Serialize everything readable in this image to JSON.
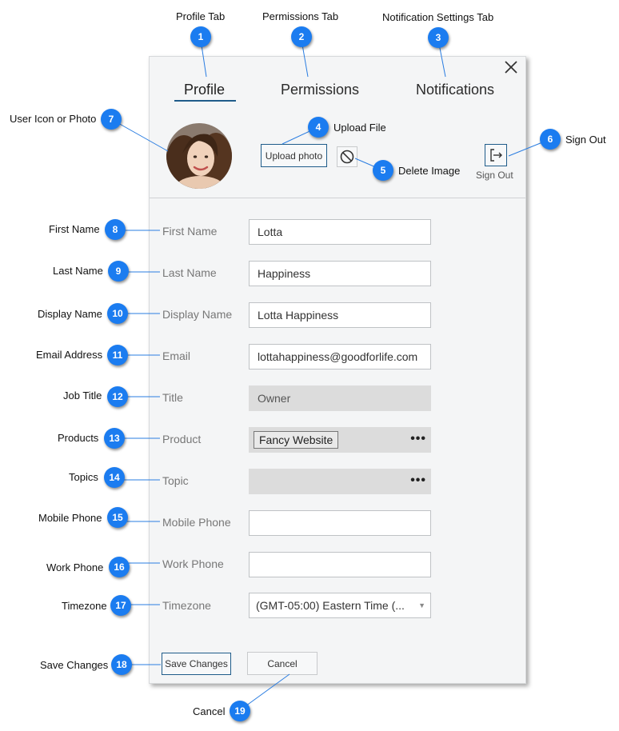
{
  "tabs": [
    {
      "label": "Profile",
      "active": true
    },
    {
      "label": "Permissions",
      "active": false
    },
    {
      "label": "Notifications",
      "active": false
    }
  ],
  "profile": {
    "upload_label": "Upload photo",
    "signout_label": "Sign Out"
  },
  "fields": {
    "first_name": {
      "label": "First Name",
      "value": "Lotta"
    },
    "last_name": {
      "label": "Last Name",
      "value": "Happiness"
    },
    "display_name": {
      "label": "Display Name",
      "value": "Lotta Happiness"
    },
    "email": {
      "label": "Email",
      "value": "lottahappiness@goodforlife.com"
    },
    "title": {
      "label": "Title",
      "value": "Owner"
    },
    "product": {
      "label": "Product",
      "chip": "Fancy Website"
    },
    "topic": {
      "label": "Topic"
    },
    "mobile_phone": {
      "label": "Mobile Phone",
      "value": ""
    },
    "work_phone": {
      "label": "Work Phone",
      "value": ""
    },
    "timezone": {
      "label": "Timezone",
      "value": "(GMT-05:00) Eastern Time (..."
    }
  },
  "more_glyph": "•••",
  "actions": {
    "save_label": "Save Changes",
    "cancel_label": "Cancel"
  },
  "annotations": [
    {
      "num": "1",
      "text": "Profile Tab"
    },
    {
      "num": "2",
      "text": "Permissions Tab"
    },
    {
      "num": "3",
      "text": "Notification Settings Tab"
    },
    {
      "num": "4",
      "text": "Upload File"
    },
    {
      "num": "5",
      "text": "Delete Image"
    },
    {
      "num": "6",
      "text": "Sign Out"
    },
    {
      "num": "7",
      "text": "User Icon or Photo"
    },
    {
      "num": "8",
      "text": "First Name"
    },
    {
      "num": "9",
      "text": "Last Name"
    },
    {
      "num": "10",
      "text": "Display Name"
    },
    {
      "num": "11",
      "text": "Email Address"
    },
    {
      "num": "12",
      "text": "Job Title"
    },
    {
      "num": "13",
      "text": "Products"
    },
    {
      "num": "14",
      "text": "Topics"
    },
    {
      "num": "15",
      "text": "Mobile Phone"
    },
    {
      "num": "16",
      "text": "Work Phone"
    },
    {
      "num": "17",
      "text": "Timezone"
    },
    {
      "num": "18",
      "text": "Save Changes"
    },
    {
      "num": "19",
      "text": "Cancel"
    }
  ],
  "colors": {
    "badge": "#1b7cf0",
    "accent": "#1f5c8a",
    "leader": "#2a7de1"
  },
  "icons": [
    "close-icon",
    "block-icon",
    "sign-out-icon",
    "chevron-down-icon"
  ]
}
